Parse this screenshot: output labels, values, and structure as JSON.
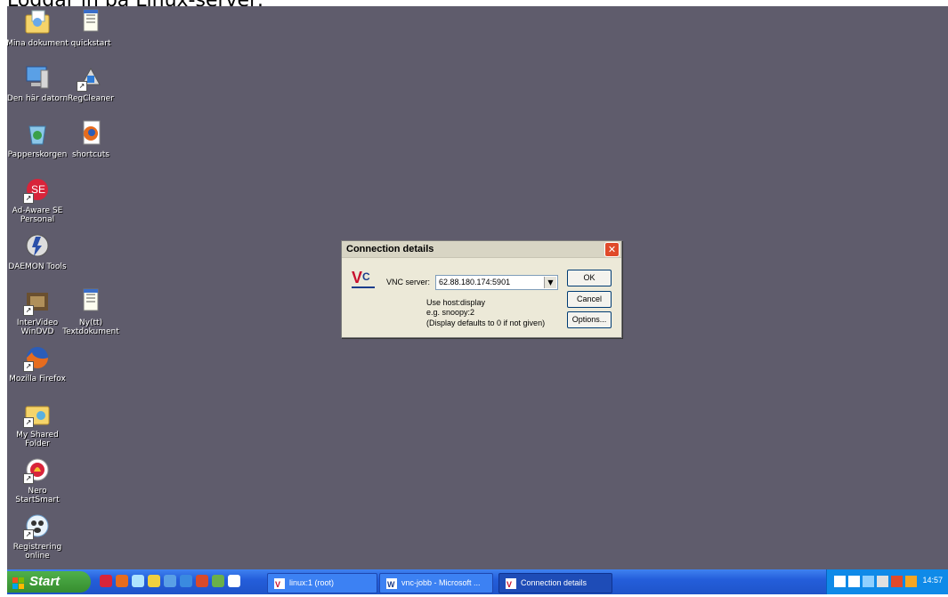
{
  "caption": "Loggar in på Linux-server:",
  "desktop_icons": [
    {
      "label": "Mina dokument",
      "icon": "folder-documents-icon"
    },
    {
      "label": "quickstart",
      "icon": "text-file-icon"
    },
    {
      "label": "Den här datorn",
      "icon": "computer-icon"
    },
    {
      "label": "RegCleaner",
      "icon": "regcleaner-icon"
    },
    {
      "label": "Papperskorgen",
      "icon": "recycle-bin-icon"
    },
    {
      "label": "shortcuts",
      "icon": "firefox-file-icon"
    },
    {
      "label": "Ad-Aware SE Personal",
      "icon": "adaware-icon"
    },
    {
      "label": "DAEMON Tools",
      "icon": "daemon-tools-icon"
    },
    {
      "label": "InterVideo WinDVD",
      "icon": "windvd-icon"
    },
    {
      "label": "Ny(tt) Textdokument",
      "icon": "text-file-icon"
    },
    {
      "label": "Mozilla Firefox",
      "icon": "firefox-icon"
    },
    {
      "label": "My Shared Folder",
      "icon": "shared-folder-icon"
    },
    {
      "label": "Nero StartSmart",
      "icon": "nero-icon"
    },
    {
      "label": "Registrering online",
      "icon": "registration-icon"
    }
  ],
  "dialog": {
    "title": "Connection details",
    "server_label": "VNC server:",
    "server_value": "62.88.180.174:5901",
    "hint_line1": "Use host:display",
    "hint_line2": "e.g. snoopy:2",
    "hint_line3": "(Display defaults to 0 if not given)",
    "ok": "OK",
    "cancel": "Cancel",
    "options": "Options...",
    "logo_text": "VC"
  },
  "taskbar": {
    "start": "Start",
    "tasks": [
      {
        "label": "linux:1 (root)",
        "icon": "vnc-icon"
      },
      {
        "label": "vnc-jobb - Microsoft ...",
        "icon": "word-icon"
      },
      {
        "label": "Connection details",
        "icon": "vnc-icon",
        "active": true
      }
    ],
    "clock": "14:57"
  },
  "colors": {
    "desktop": "#5f5c6c",
    "taskbar": "#245edb",
    "start": "#378d2f",
    "tray": "#0f8ae8",
    "dialog": "#ece9d8"
  }
}
